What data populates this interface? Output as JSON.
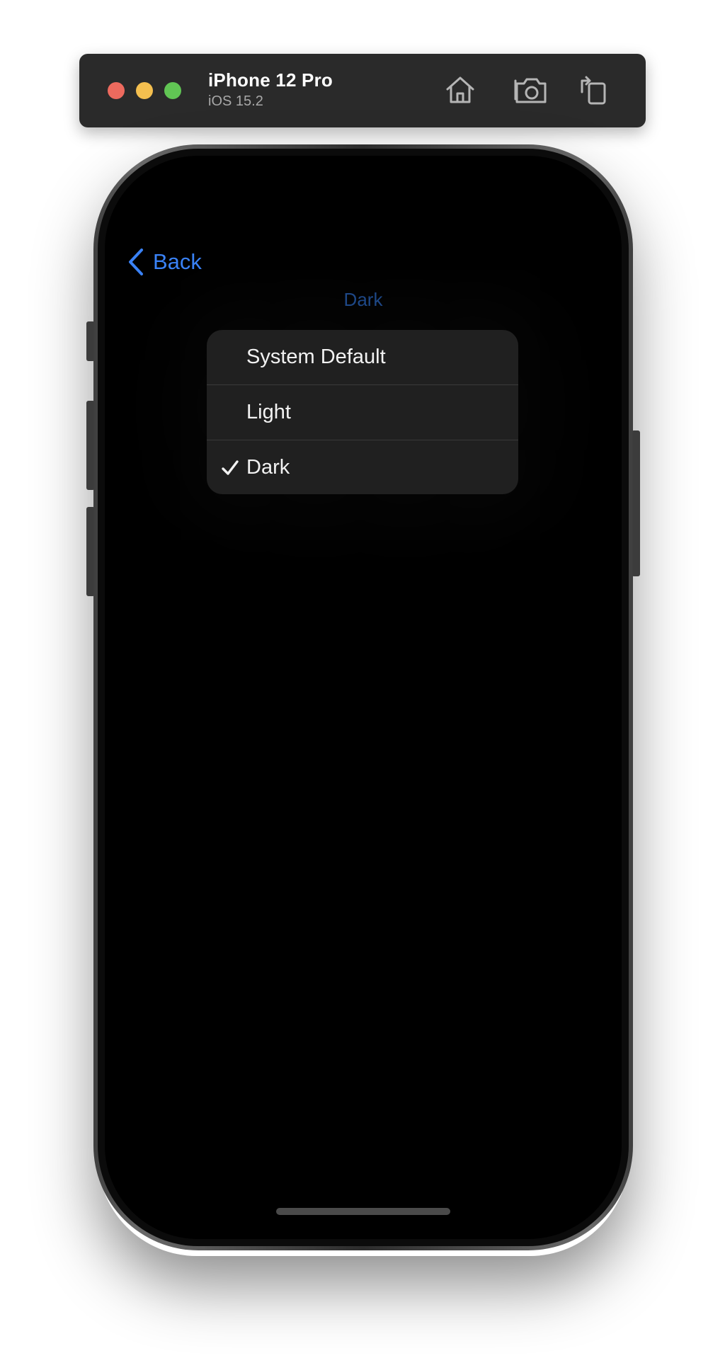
{
  "simulator": {
    "device_name": "iPhone 12 Pro",
    "os_version": "iOS 15.2",
    "toolbar_icons": [
      "home-icon",
      "screenshot-icon",
      "rotate-icon"
    ],
    "traffic_colors": {
      "close": "#ed6a5e",
      "minimize": "#f4bf4f",
      "zoom": "#61c554"
    }
  },
  "nav": {
    "back_label": "Back",
    "accent_color": "#3a82f6"
  },
  "picker": {
    "current_value": "Dark",
    "options": [
      {
        "label": "System Default",
        "selected": false
      },
      {
        "label": "Light",
        "selected": false
      },
      {
        "label": "Dark",
        "selected": true
      }
    ]
  }
}
